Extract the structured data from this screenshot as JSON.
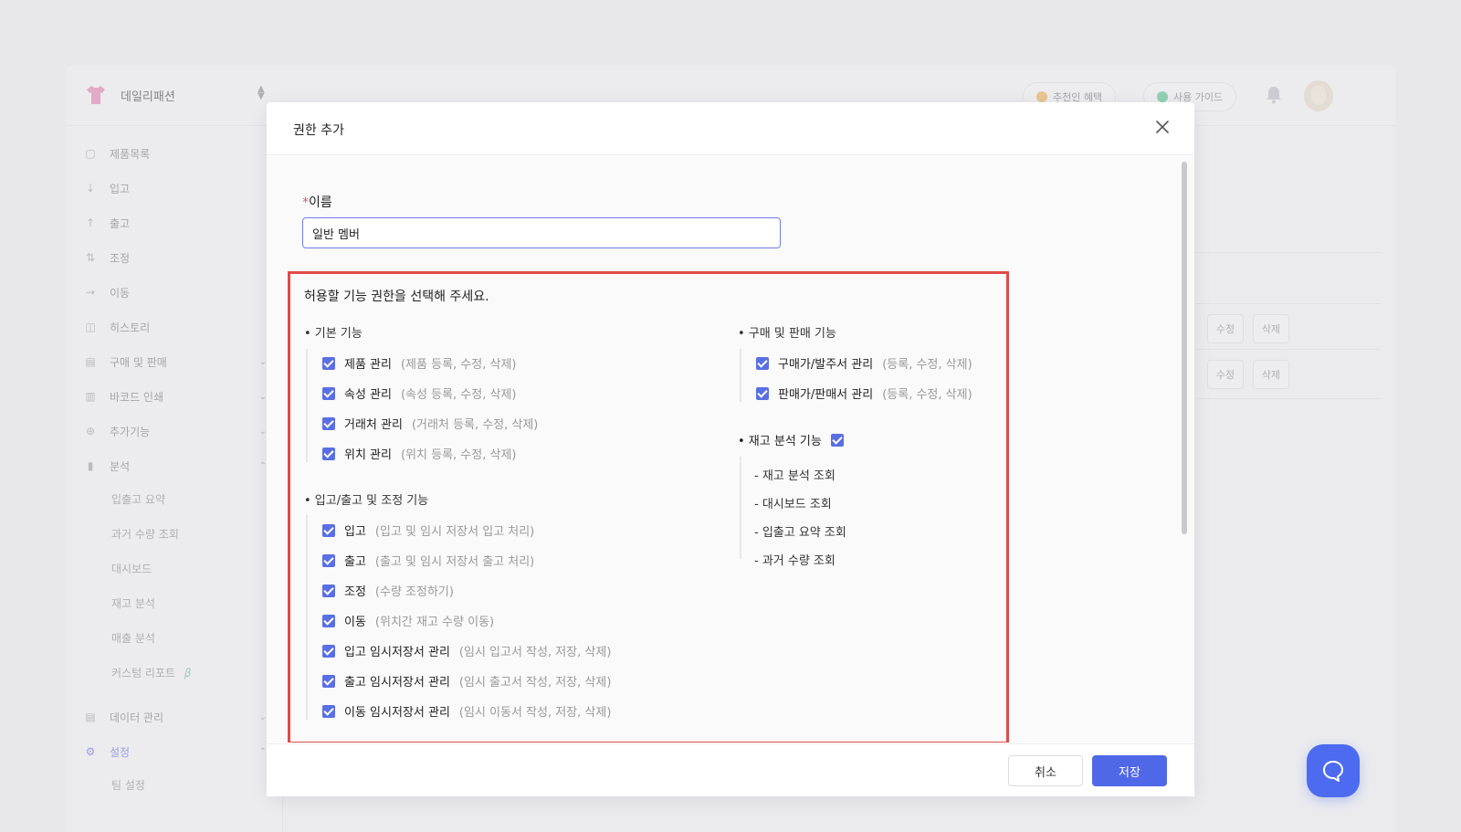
{
  "app": {
    "brand_name": "데일리패션",
    "top_pills": {
      "referral": "추천인 혜택",
      "guide": "사용 가이드"
    }
  },
  "sidebar": {
    "items": [
      {
        "label": "제품목록",
        "icon": "box-icon"
      },
      {
        "label": "입고",
        "icon": "arrow-down-icon"
      },
      {
        "label": "출고",
        "icon": "arrow-up-icon"
      },
      {
        "label": "조정",
        "icon": "swap-icon"
      },
      {
        "label": "이동",
        "icon": "arrow-right-icon"
      },
      {
        "label": "히스토리",
        "icon": "history-icon"
      },
      {
        "label": "구매 및 판매",
        "icon": "document-icon"
      },
      {
        "label": "바코드 인쇄",
        "icon": "barcode-icon"
      },
      {
        "label": "추가기능",
        "icon": "plus-circle-icon"
      },
      {
        "label": "분석",
        "icon": "chart-icon"
      }
    ],
    "analysis_sub": [
      "입출고 요약",
      "과거 수량 조회",
      "대시보드",
      "재고 분석",
      "매출 분석",
      "커스텀 리포트"
    ],
    "beta": "β",
    "data_manage": "데이터 관리",
    "settings": "설정",
    "team_settings": "팀 설정"
  },
  "background_buttons": {
    "edit": "수정",
    "delete": "삭제"
  },
  "modal": {
    "title": "권한 추가",
    "name_label": "이름",
    "name_required_mark": "*",
    "name_value": "일반 멤버",
    "permissions_title": "허용할 기능 권한을 선택해 주세요.",
    "basic": {
      "title": "• 기본 기능",
      "items": [
        {
          "name": "제품 관리",
          "desc": "(제품 등록, 수정, 삭제)",
          "checked": true
        },
        {
          "name": "속성 관리",
          "desc": "(속성 등록, 수정, 삭제)",
          "checked": true
        },
        {
          "name": "거래처 관리",
          "desc": "(거래처 등록, 수정, 삭제)",
          "checked": true
        },
        {
          "name": "위치 관리",
          "desc": "(위치 등록, 수정, 삭제)",
          "checked": true
        }
      ]
    },
    "inout": {
      "title": "• 입고/출고 및 조정 기능",
      "items": [
        {
          "name": "입고",
          "desc": "(입고 및 임시 저장서 입고 처리)",
          "checked": true
        },
        {
          "name": "출고",
          "desc": "(출고 및 임시 저장서 출고 처리)",
          "checked": true
        },
        {
          "name": "조정",
          "desc": "(수량 조정하기)",
          "checked": true
        },
        {
          "name": "이동",
          "desc": "(위치간 재고 수량 이동)",
          "checked": true
        },
        {
          "name": "입고 임시저장서 관리",
          "desc": "(임시 입고서 작성, 저장, 삭제)",
          "checked": true
        },
        {
          "name": "출고 임시저장서 관리",
          "desc": "(임시 출고서 작성, 저장, 삭제)",
          "checked": true
        },
        {
          "name": "이동 임시저장서 관리",
          "desc": "(임시 이동서 작성, 저장, 삭제)",
          "checked": true
        }
      ]
    },
    "purchase": {
      "title": "• 구매 및 판매 기능",
      "items": [
        {
          "name": "구매가/발주서 관리",
          "desc": "(등록, 수정, 삭제)",
          "checked": true
        },
        {
          "name": "판매가/판매서 관리",
          "desc": "(등록, 수정, 삭제)",
          "checked": true
        }
      ]
    },
    "stock_analysis": {
      "title": "• 재고 분석 기능",
      "checked": true,
      "items": [
        "- 재고 분석 조회",
        "- 대시보드 조회",
        "- 입출고 요약 조회",
        "- 과거 수량 조회"
      ]
    },
    "cancel_label": "취소",
    "save_label": "저장"
  },
  "colors": {
    "accent": "#4f68e8",
    "highlight_border": "#e04a4a",
    "checkbox": "#5a6fe3"
  }
}
